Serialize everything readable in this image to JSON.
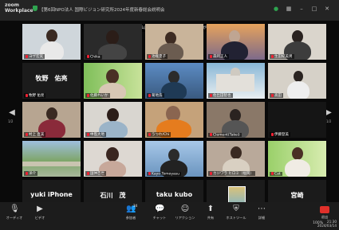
{
  "app": {
    "logo_line1": "zoom",
    "logo_line2": "Workplace",
    "meeting_title": "【第6回NPO法人 国際ビジョン研究所2024年度新春総会説明会"
  },
  "speaker_banner": "片山真吾（国際ビジョン研究所 理事長）が発言中...",
  "page_left": "1/2",
  "page_right": "1/2",
  "tiles": [
    {
      "label": "ヨザ宏実",
      "big": ""
    },
    {
      "label": "Chika",
      "big": ""
    },
    {
      "label": "池端夏子",
      "big": ""
    },
    {
      "label": "森岡正人",
      "big": ""
    },
    {
      "label": "生田紀美男",
      "big": ""
    },
    {
      "label": "牧野 佑亮",
      "big": "牧野　佑亮"
    },
    {
      "label": "佐藤れいか",
      "big": ""
    },
    {
      "label": "菊地浩",
      "big": ""
    },
    {
      "label": "佐出田智也",
      "big": ""
    },
    {
      "label": "高田",
      "big": ""
    },
    {
      "label": "村上 直美",
      "big": ""
    },
    {
      "label": "中島大地",
      "big": ""
    },
    {
      "label": "うつわ/Chi",
      "big": ""
    },
    {
      "label": "Clement(Takei)",
      "big": ""
    },
    {
      "label": "伊藤登美",
      "big": ""
    },
    {
      "label": "洋介",
      "big": ""
    },
    {
      "label": "国仲百世",
      "big": ""
    },
    {
      "label": "Kayo Tomoyasu",
      "big": ""
    },
    {
      "label": "カジワラ ヒロミ（福岡）",
      "big": ""
    },
    {
      "label": "Cat",
      "big": ""
    },
    {
      "label": "yuki iPhone",
      "big": "yuki iPhone"
    },
    {
      "label": "石川 茂",
      "big": "石川　茂"
    },
    {
      "label": "taku kubo",
      "big": "taku kubo"
    },
    {
      "label": "かれ",
      "big": ""
    },
    {
      "label": "宮崎",
      "big": "宮崎"
    }
  ],
  "toolbar": {
    "audio": "オーディオ",
    "video": "ビデオ",
    "participants": "参加者",
    "participants_count": "34",
    "chat": "チャット",
    "reactions": "リアクション",
    "share": "共有",
    "host_tools": "ホストツール",
    "more": "詳細",
    "end": "退出"
  },
  "tray_text": "100%",
  "clock": {
    "time": "21:30",
    "date": "2024/03/14"
  },
  "colors": {
    "accent": "#2ea44f",
    "end": "#e0302a"
  }
}
